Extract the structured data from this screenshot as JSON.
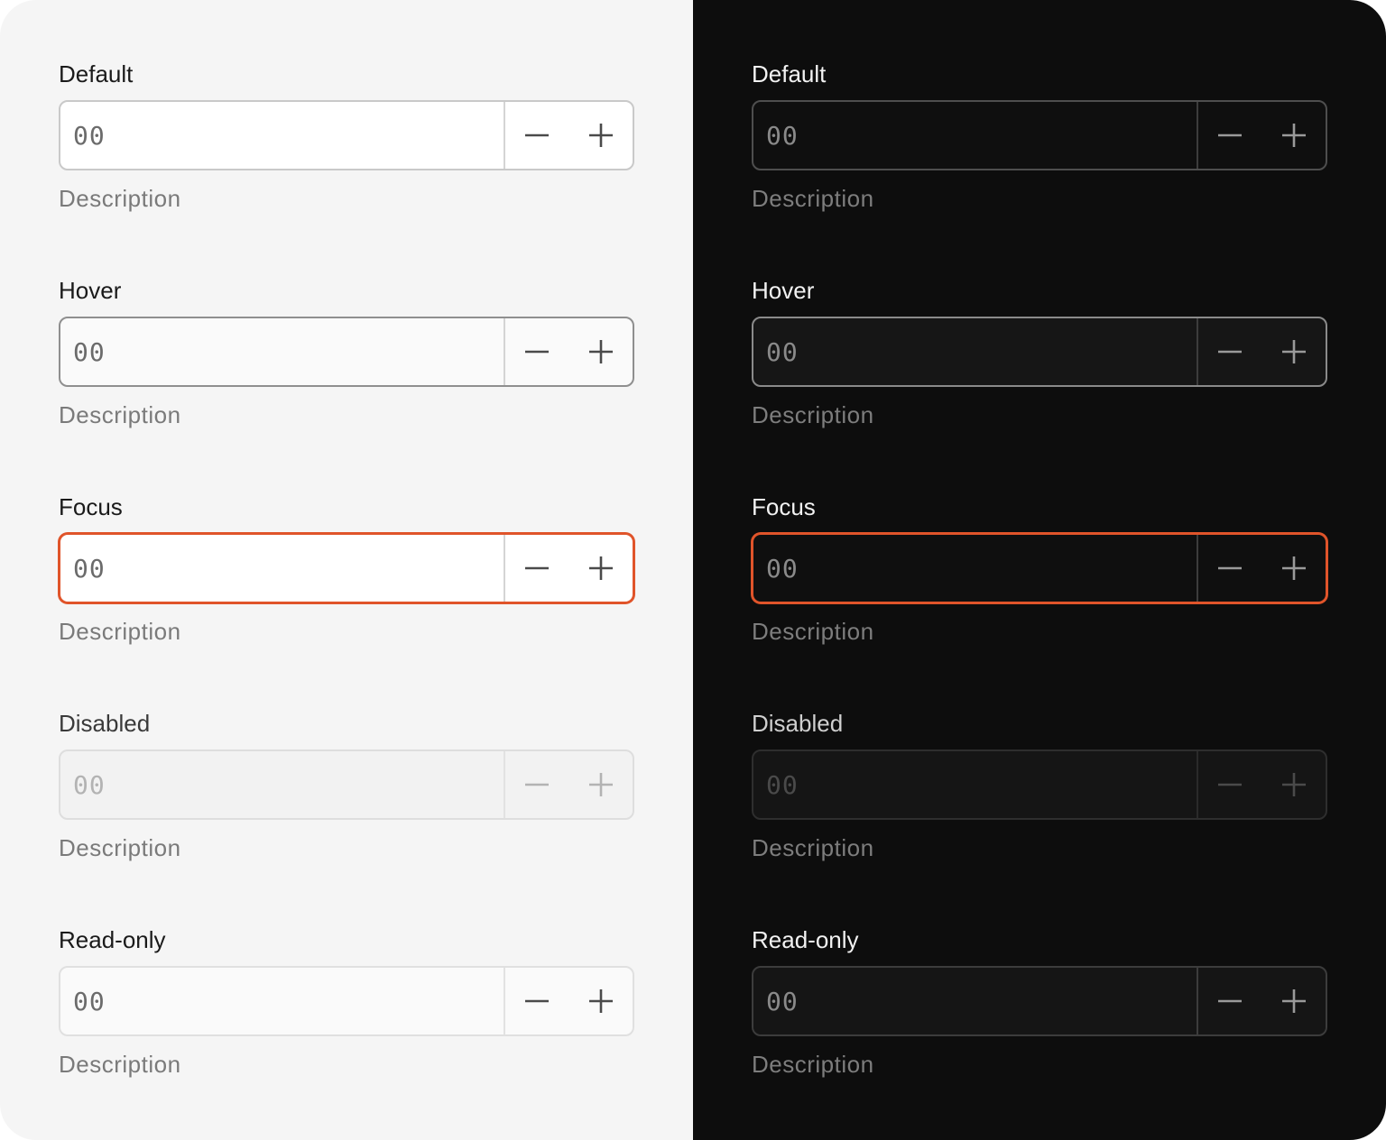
{
  "themes": {
    "light": {
      "background": "#f5f5f5",
      "accent": "#e0542a"
    },
    "dark": {
      "background": "#0d0d0d",
      "accent": "#e0542a"
    }
  },
  "states": [
    {
      "id": "default",
      "label": "Default",
      "value": "00",
      "description": "Description"
    },
    {
      "id": "hover",
      "label": "Hover",
      "value": "00",
      "description": "Description"
    },
    {
      "id": "focus",
      "label": "Focus",
      "value": "00",
      "description": "Description"
    },
    {
      "id": "disabled",
      "label": "Disabled",
      "value": "00",
      "description": "Description"
    },
    {
      "id": "readonly",
      "label": "Read-only",
      "value": "00",
      "description": "Description"
    }
  ],
  "icons": {
    "decrement": "minus-icon",
    "increment": "plus-icon"
  }
}
